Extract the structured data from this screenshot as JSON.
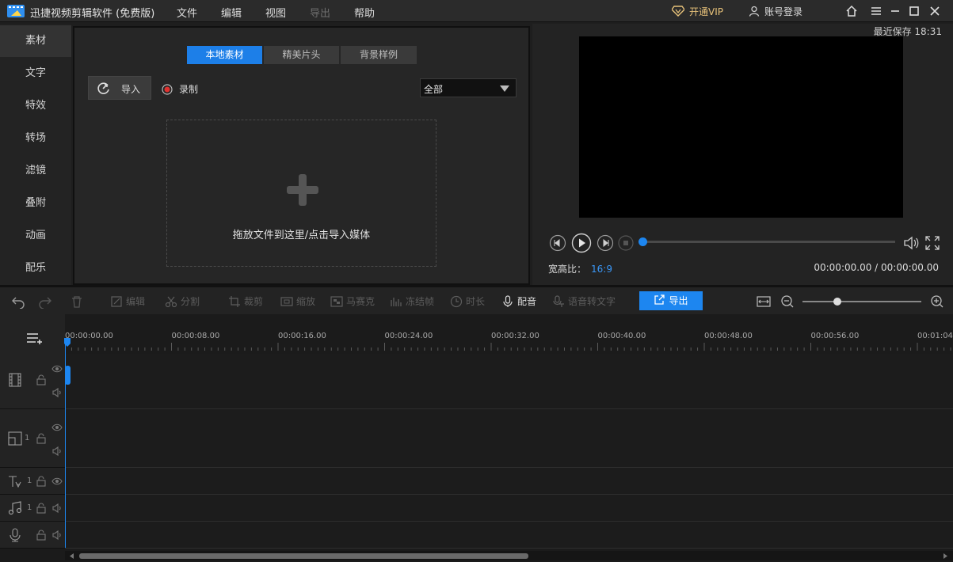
{
  "titlebar": {
    "app_title": "迅捷视频剪辑软件 (免费版)",
    "menus": [
      "文件",
      "编辑",
      "视图",
      "导出",
      "帮助"
    ],
    "vip_label": "开通VIP",
    "account_label": "账号登录"
  },
  "sidebar": {
    "items": [
      "素材",
      "文字",
      "特效",
      "转场",
      "滤镜",
      "叠附",
      "动画",
      "配乐"
    ]
  },
  "media": {
    "tabs": [
      "本地素材",
      "精美片头",
      "背景样例"
    ],
    "import_label": "导入",
    "record_label": "录制",
    "filter_value": "全部",
    "dropzone_text": "拖放文件到这里/点击导入媒体"
  },
  "preview": {
    "save_status": "最近保存 18:31",
    "ratio_label": "宽高比：",
    "ratio_value": "16:9",
    "timecode": "00:00:00.00 / 00:00:00.00",
    "progress": 0
  },
  "toolbar": {
    "tools": [
      "编辑",
      "分割",
      "裁剪",
      "缩放",
      "马赛克",
      "冻结帧",
      "时长",
      "配音",
      "语音转文字"
    ],
    "export_label": "导出"
  },
  "timeline": {
    "ticks": [
      "00:00:00.00",
      "00:00:08.00",
      "00:00:16.00",
      "00:00:24.00",
      "00:00:32.00",
      "00:00:40.00",
      "00:00:48.00",
      "00:00:56.00",
      "00:01:04"
    ],
    "track_numbers": [
      "1",
      "1",
      "1"
    ]
  },
  "colors": {
    "accent": "#1d86f0",
    "vip": "#e8c27a"
  }
}
